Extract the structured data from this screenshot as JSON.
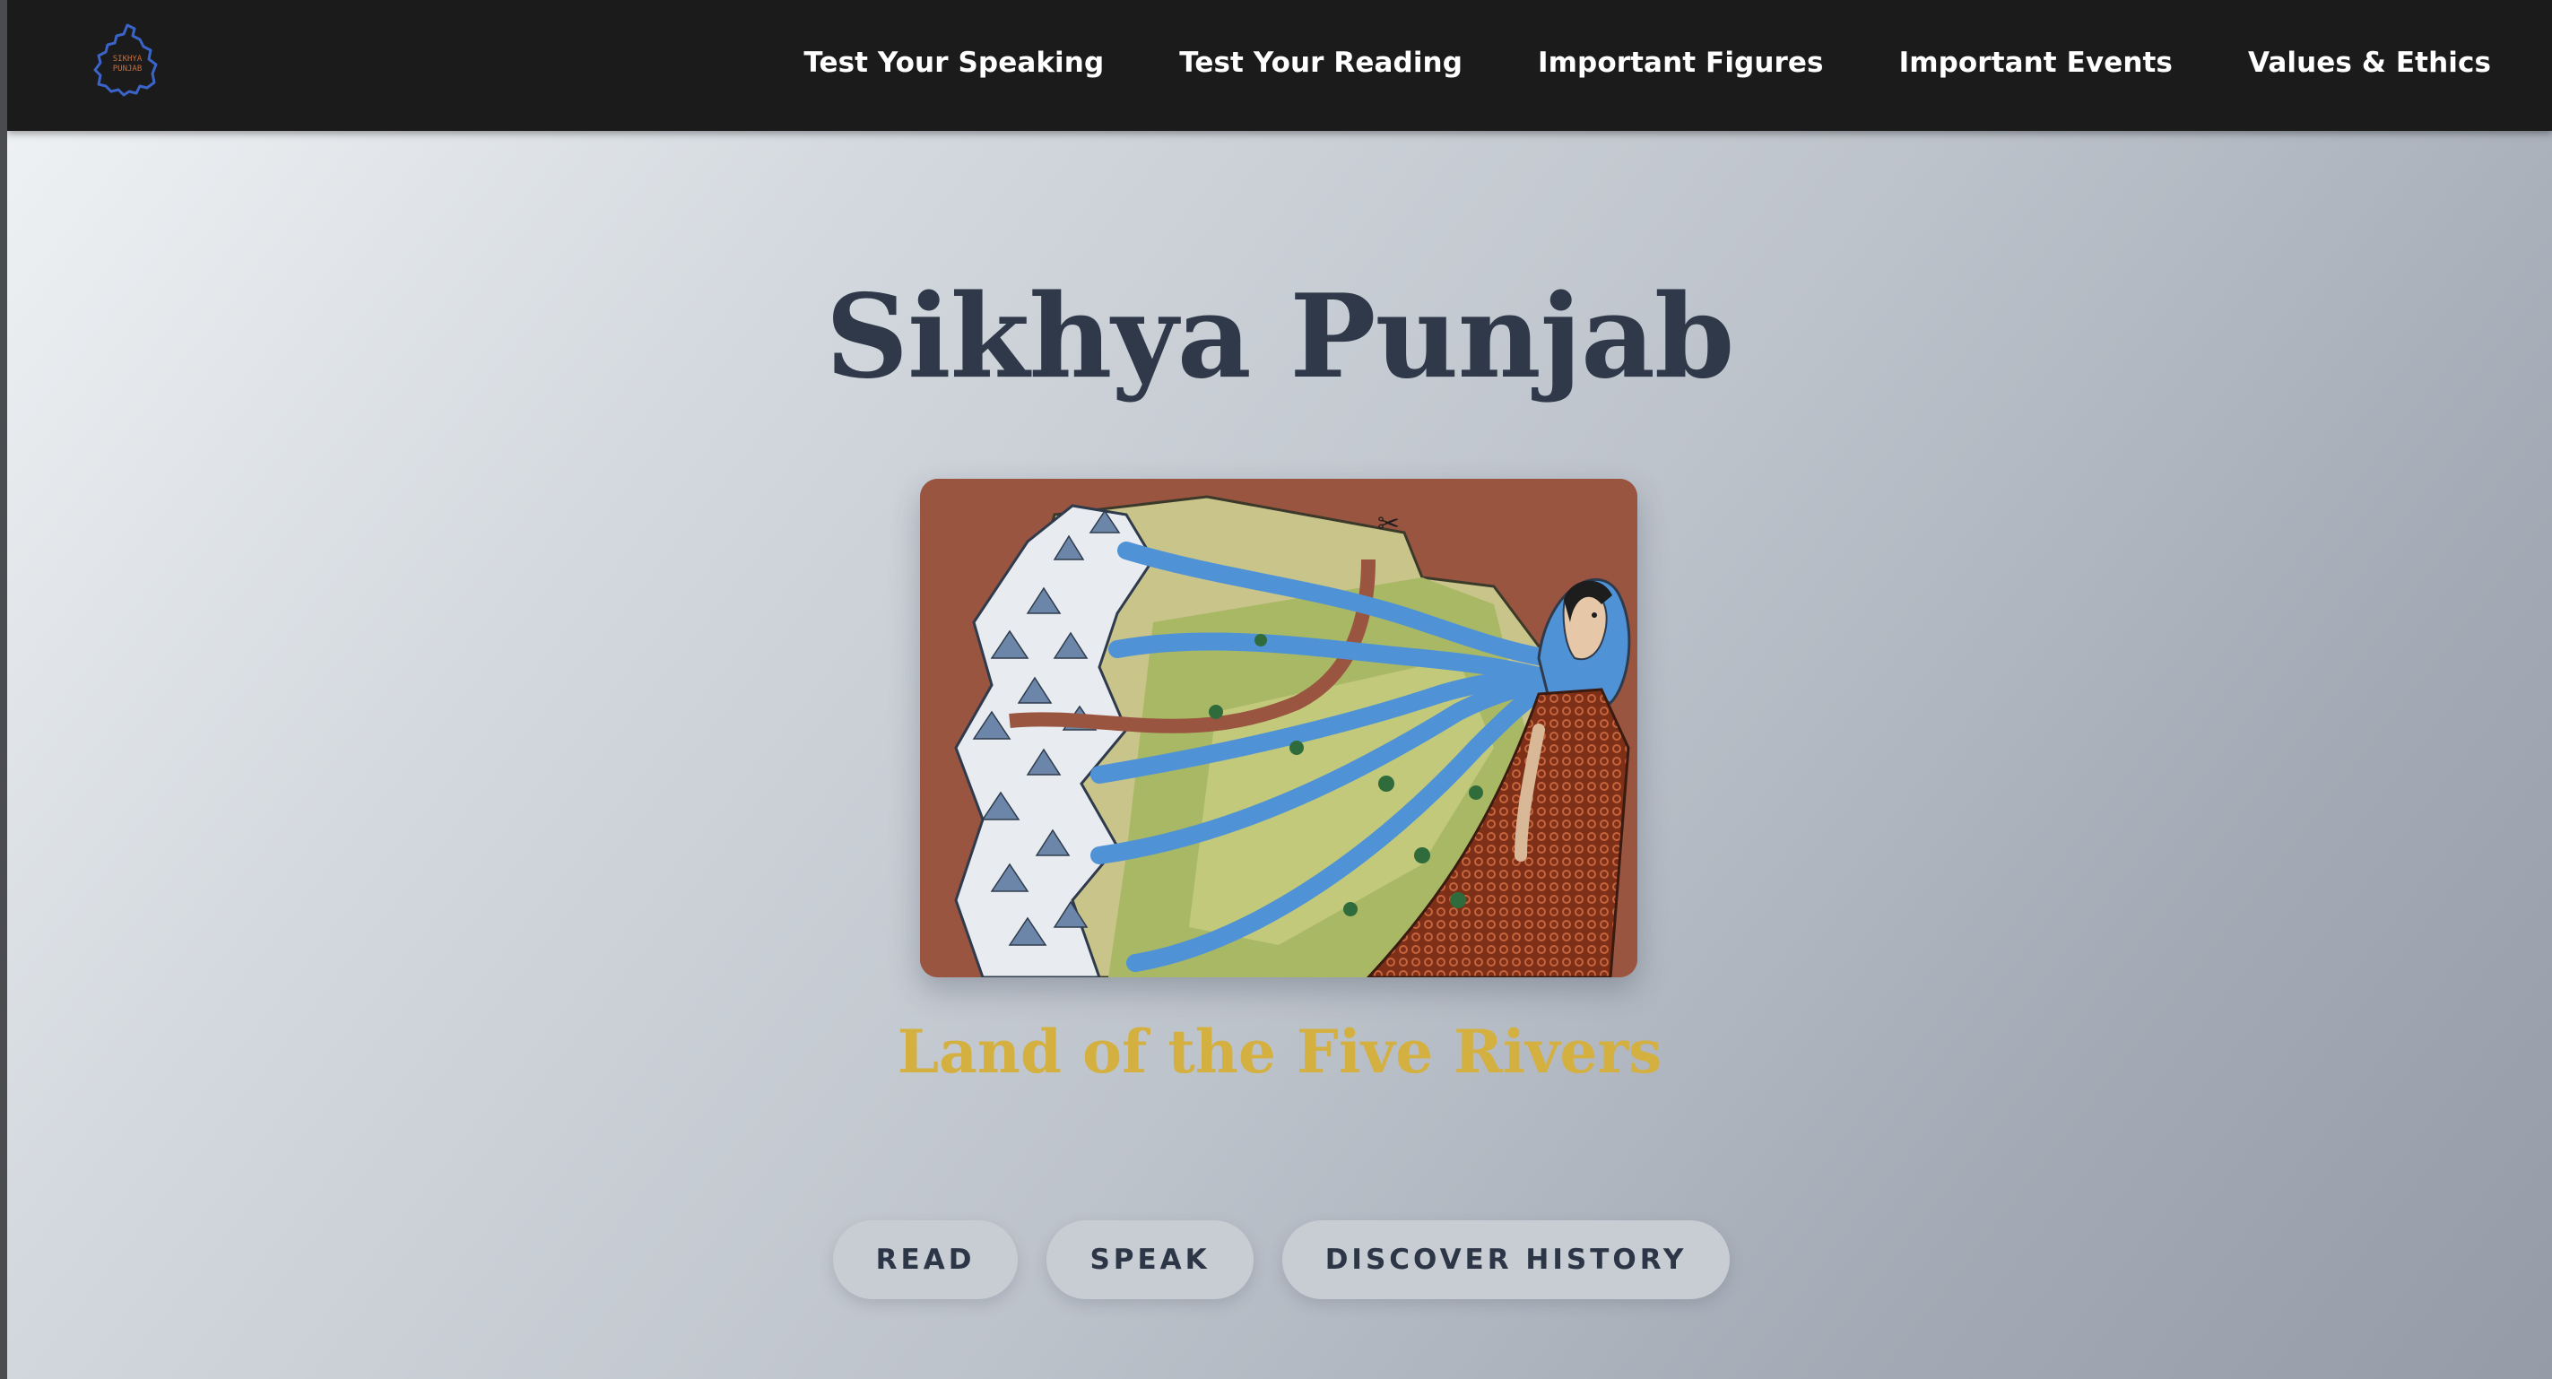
{
  "nav": {
    "logo_icon": "punjab-map-logo-icon",
    "logo_text": [
      "SIKHYA",
      "PUNJAB"
    ],
    "links": [
      {
        "label": "Test Your Speaking"
      },
      {
        "label": "Test Your Reading"
      },
      {
        "label": "Important Figures"
      },
      {
        "label": "Important Events"
      },
      {
        "label": "Values & Ethics"
      }
    ]
  },
  "hero": {
    "title": "Sikhya Punjab",
    "image_icon": "five-rivers-illustration",
    "tagline": "Land of the Five Rivers",
    "buttons": [
      {
        "label": "READ"
      },
      {
        "label": "SPEAK"
      },
      {
        "label": "DISCOVER HISTORY"
      }
    ]
  },
  "colors": {
    "navbar": "#1b1b1c",
    "title": "#2f3949",
    "tagline": "#d4b040",
    "button_bg": "#c8cdd4",
    "image_bg": "#9a5540"
  }
}
